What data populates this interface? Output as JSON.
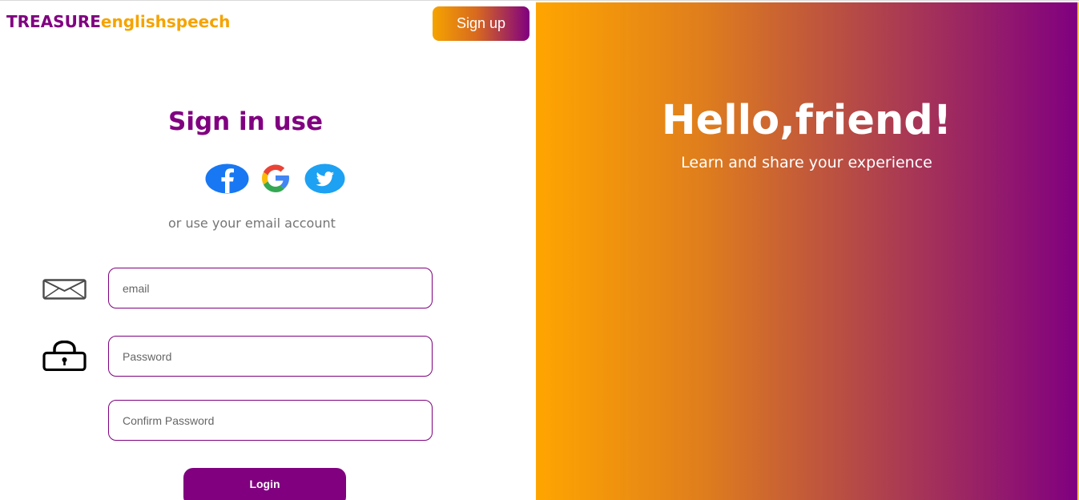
{
  "brand": {
    "part1": "TREASURE",
    "part2": "englishspeech"
  },
  "header": {
    "signup_label": "Sign up"
  },
  "signin": {
    "title": "Sign in use",
    "alt_text": "or use your email account",
    "social": [
      "facebook-icon",
      "google-icon",
      "twitter-icon"
    ]
  },
  "form": {
    "email_placeholder": "email",
    "password_placeholder": "Password",
    "confirm_placeholder": "Confirm Password",
    "login_label": "Login"
  },
  "welcome": {
    "heading": "Hello,friend!",
    "subheading": "Learn and share your experience"
  },
  "colors": {
    "primary": "#800080",
    "accent": "#ffa500"
  }
}
